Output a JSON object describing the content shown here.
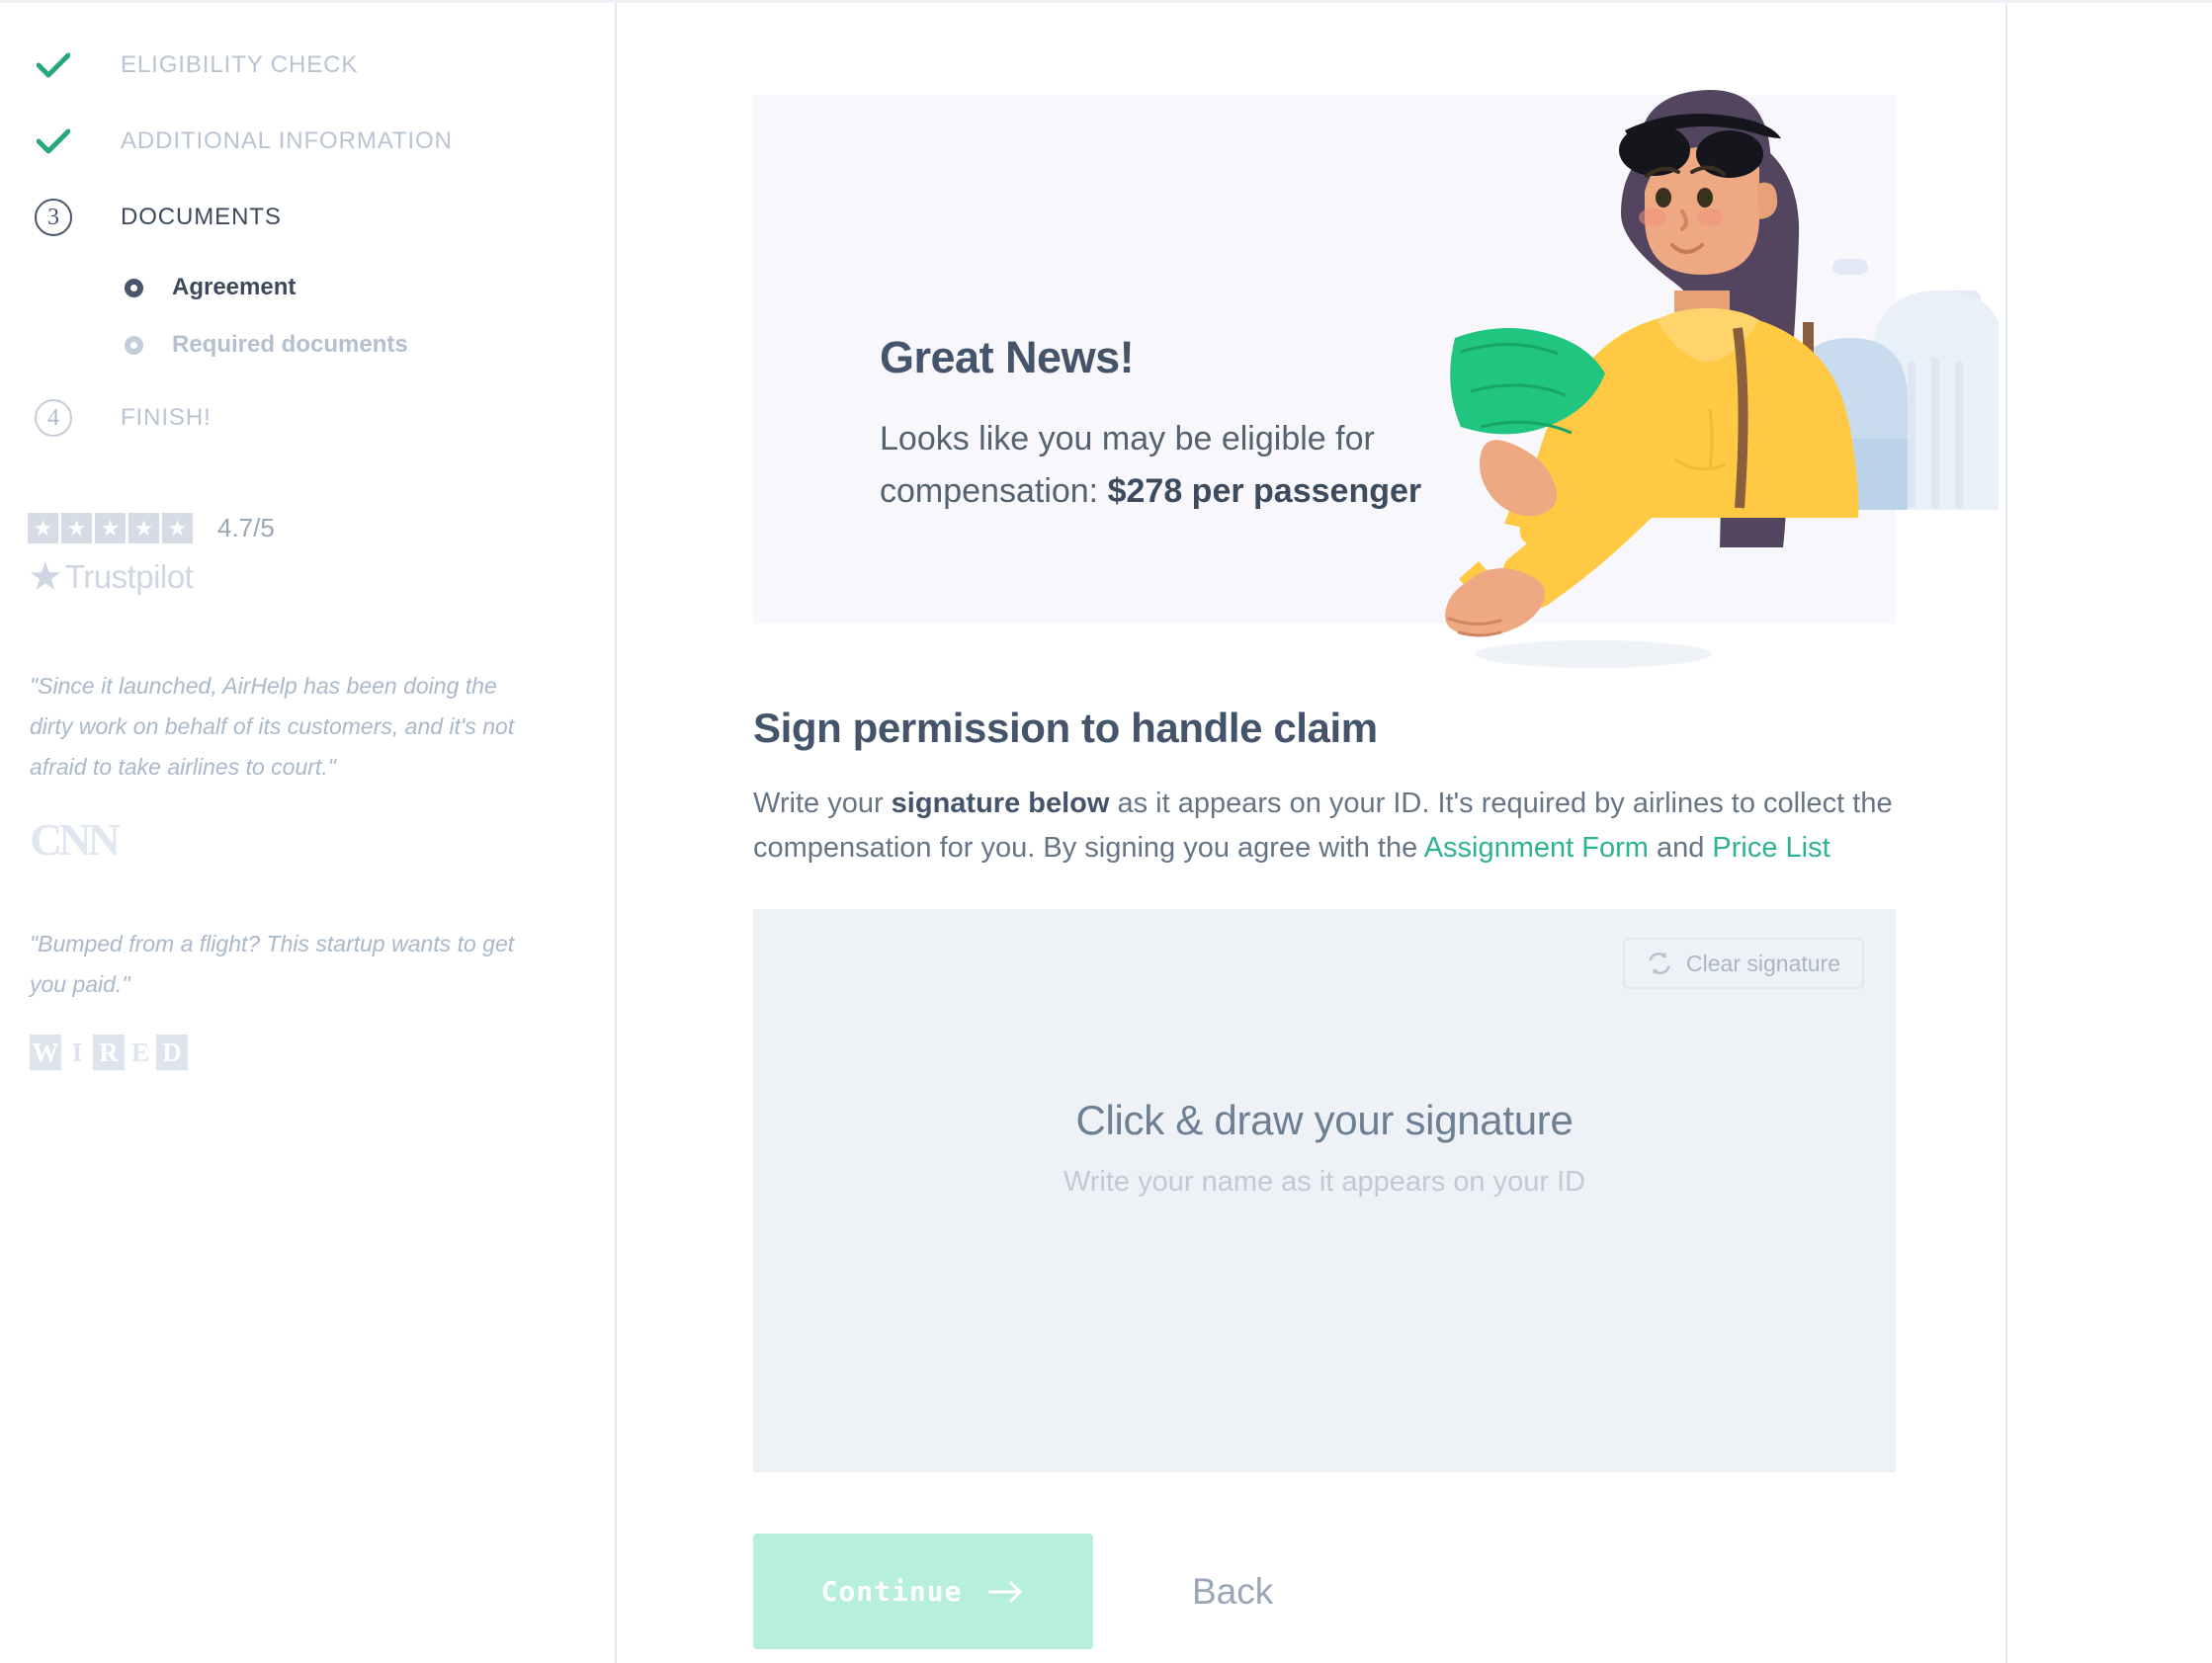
{
  "sidebar": {
    "steps": [
      {
        "marker": "check",
        "label": "ELIGIBILITY CHECK",
        "state": "done"
      },
      {
        "marker": "check",
        "label": "ADDITIONAL INFORMATION",
        "state": "done"
      },
      {
        "marker": "3",
        "label": "DOCUMENTS",
        "state": "active"
      },
      {
        "marker": "4",
        "label": "FINISH!",
        "state": "upcoming"
      }
    ],
    "substeps": [
      {
        "label": "Agreement",
        "state": "active"
      },
      {
        "label": "Required documents",
        "state": "upcoming"
      }
    ],
    "trustpilot": {
      "rating": "4.7/5",
      "brand": "Trustpilot",
      "stars": 5,
      "star_glyph": "★"
    },
    "quotes": [
      {
        "text": "\"Since it launched, AirHelp has been doing the dirty work on behalf of its customers, and it's not afraid to take airlines to court.\"",
        "source": "CNN"
      },
      {
        "text": "\"Bumped from a flight? This startup wants to get you paid.\"",
        "source": "WIRED"
      }
    ]
  },
  "banner": {
    "title": "Great News!",
    "subtitle_prefix": "Looks like you may be eligible for compensation: ",
    "amount": "$278 per passenger",
    "background": "#f7f7fc",
    "illustration": "woman-holding-cash-illustration"
  },
  "main": {
    "section_title": "Sign permission to handle claim",
    "body": {
      "part1": "Write your ",
      "bold1": "signature below",
      "part2": " as it appears on your ID. It's required by airlines to collect the compensation for you. By signing you agree with the ",
      "link1": "Assignment Form",
      "part3": " and ",
      "link2": "Price List"
    },
    "signature": {
      "clear_label": "Clear signature",
      "clear_icon": "refresh-icon",
      "placeholder_main": "Click & draw your signature",
      "placeholder_sub": "Write your name as it appears on your ID",
      "background": "#eef2f7"
    },
    "actions": {
      "continue_label": "Continue",
      "continue_icon": "arrow-right-icon",
      "back_label": "Back",
      "continue_color": "#b6f0da"
    }
  },
  "colors": {
    "accent_green": "#2eb392",
    "check_green": "#26a87f",
    "text_dark": "#44556b",
    "text_muted": "#b9c4d2"
  }
}
